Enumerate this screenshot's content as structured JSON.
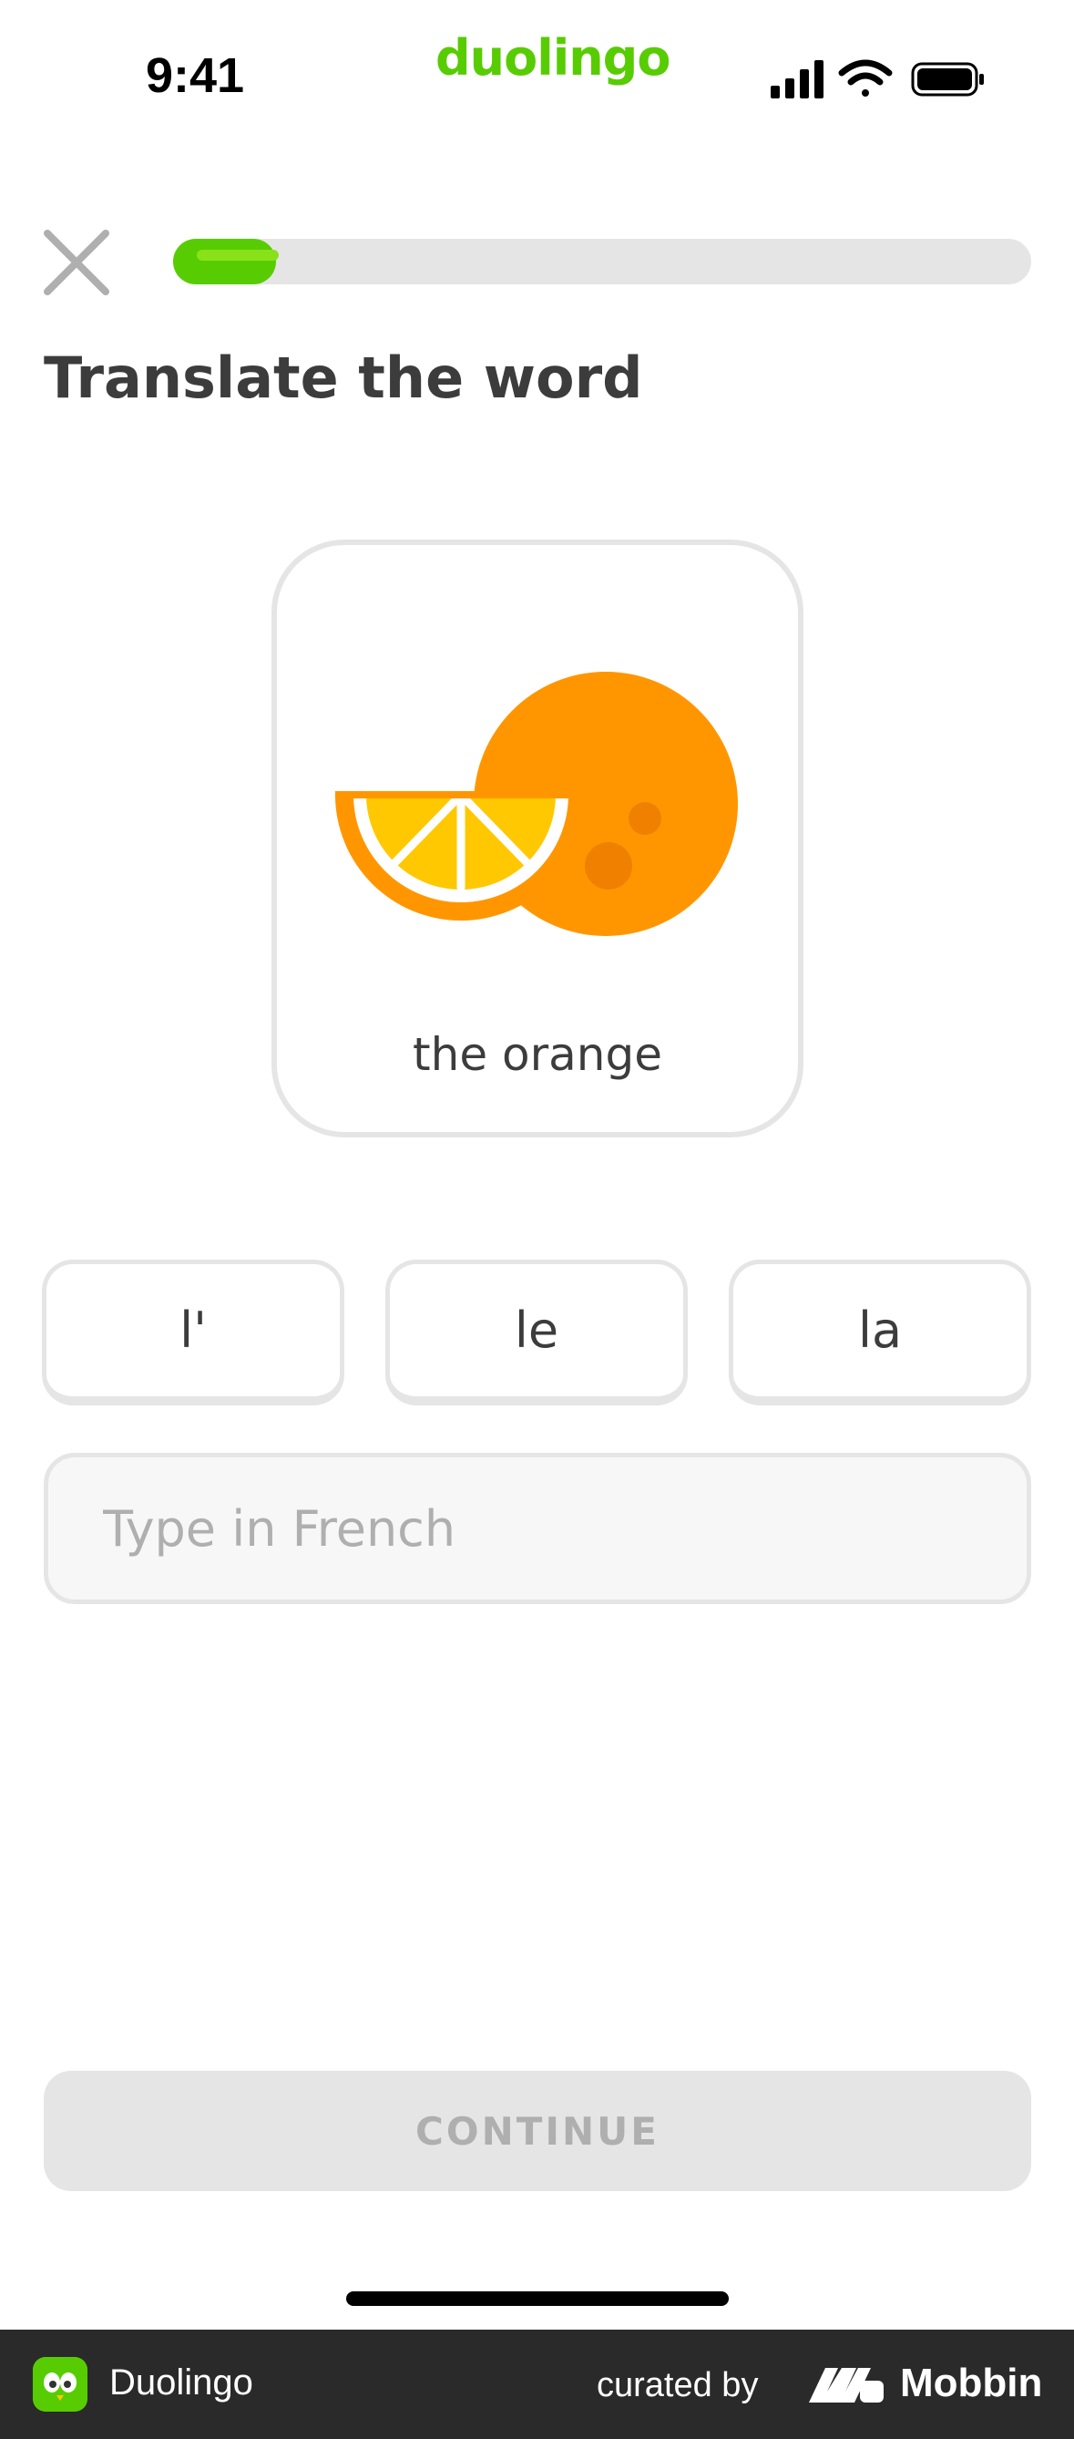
{
  "status_bar": {
    "time": "9:41",
    "brand": "duolingo"
  },
  "lesson": {
    "progress_percent": 12,
    "instruction": "Translate the word",
    "card": {
      "image": "orange-illustration",
      "label": "the orange"
    },
    "word_choices": [
      "l'",
      "le",
      "la"
    ],
    "answer": {
      "placeholder": "Type in French",
      "value": ""
    },
    "continue_label": "CONTINUE"
  },
  "footer": {
    "app_name": "Duolingo",
    "curated_by": "curated by",
    "brand": "Mobbin"
  },
  "colors": {
    "accent": "#58cc02",
    "orange": "#ff9600",
    "orange_light": "#ffc800",
    "disabled": "#e5e5e5",
    "text": "#3c3c3c"
  }
}
